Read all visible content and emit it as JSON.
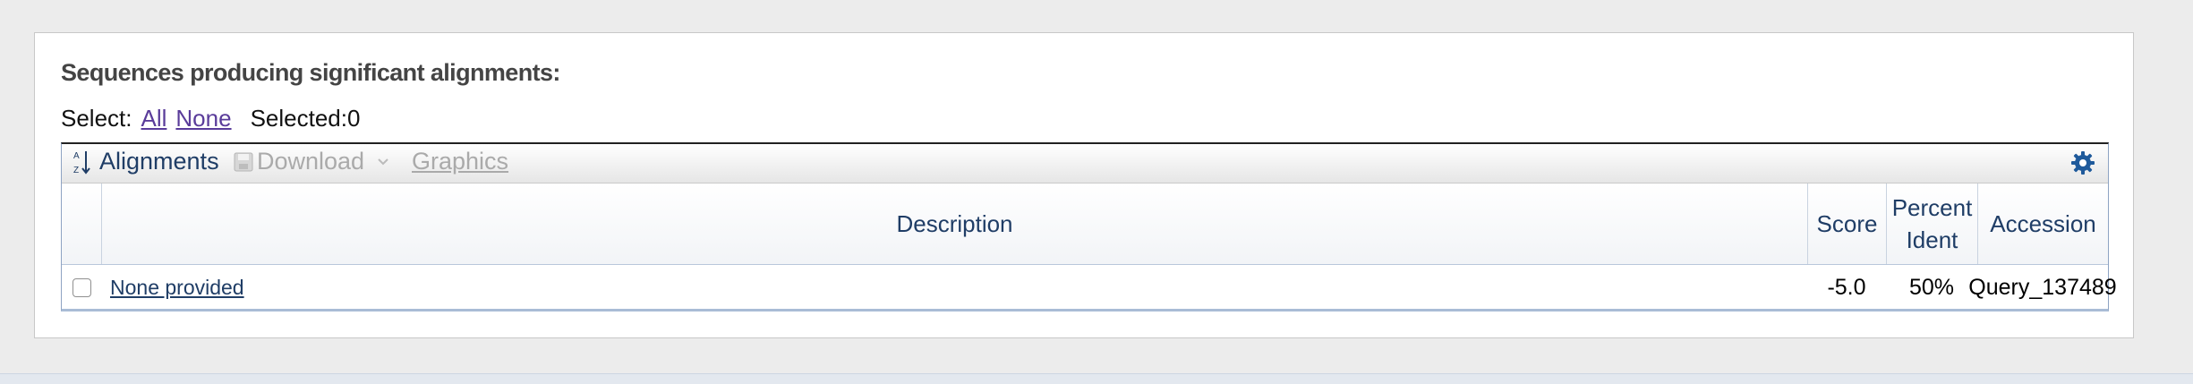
{
  "section": {
    "heading": "Sequences producing significant alignments:"
  },
  "select": {
    "label": "Select:",
    "all": "All",
    "none": "None",
    "selected": "Selected:0"
  },
  "toolbar": {
    "alignments": "Alignments",
    "download": "Download",
    "graphics": "Graphics",
    "icons": {
      "alignments": "sort-icon",
      "download": "save-icon",
      "dropdown": "chevron-down-icon",
      "settings": "gear-icon"
    }
  },
  "table": {
    "headers": {
      "description": "Description",
      "score": "Score",
      "percent_ident": [
        "Percent",
        "Ident"
      ],
      "accession": "Accession"
    },
    "rows": [
      {
        "checked": false,
        "description": "None provided",
        "score": "-5.0",
        "percent_ident": "50%",
        "accession": "Query_137489"
      }
    ]
  },
  "colors": {
    "link": "#1f3d66",
    "visited_link": "#5a3c9a",
    "gear": "#1f5a9b",
    "disabled": "#aaaaaa"
  }
}
